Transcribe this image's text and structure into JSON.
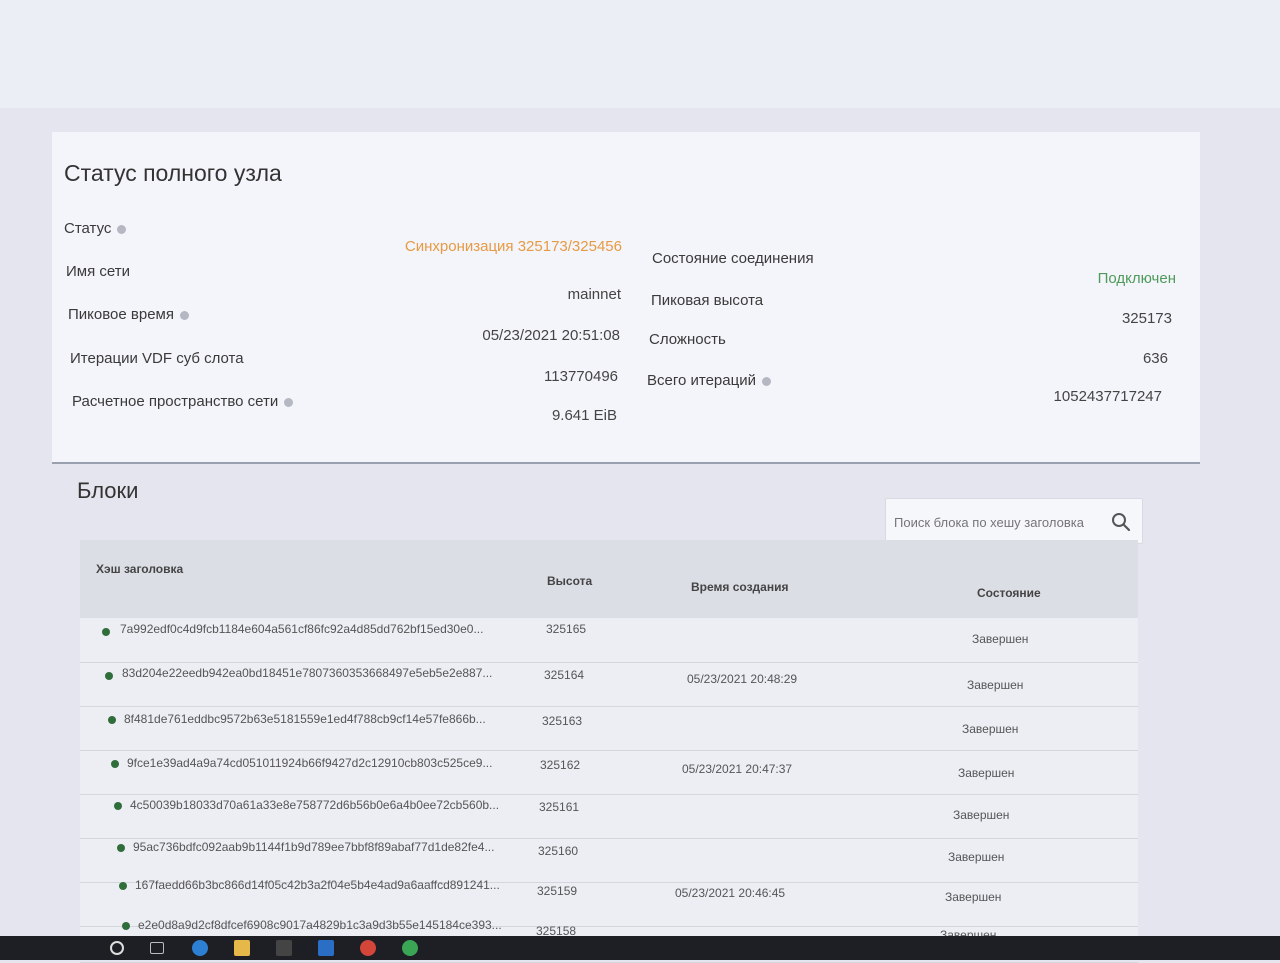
{
  "node_status": {
    "title": "Статус полного узла",
    "left": [
      {
        "label": "Статус",
        "help": true,
        "value": "Синхронизация 325173/325456",
        "tone": "orange"
      },
      {
        "label": "Имя сети",
        "help": false,
        "value": "mainnet",
        "tone": ""
      },
      {
        "label": "Пиковое время",
        "help": true,
        "value": "05/23/2021 20:51:08",
        "tone": ""
      },
      {
        "label": "Итерации VDF суб слота",
        "help": false,
        "value": "113770496",
        "tone": ""
      },
      {
        "label": "Расчетное пространство сети",
        "help": true,
        "value": "9.641 EiB",
        "tone": ""
      }
    ],
    "right": [
      {
        "label": "Состояние соединения",
        "help": false,
        "value": "Подключен",
        "tone": "green"
      },
      {
        "label": "Пиковая высота",
        "help": false,
        "value": "325173",
        "tone": ""
      },
      {
        "label": "Сложность",
        "help": false,
        "value": "636",
        "tone": ""
      },
      {
        "label": "Всего итераций",
        "help": true,
        "value": "1052437717247",
        "tone": ""
      }
    ]
  },
  "blocks": {
    "title": "Блоки",
    "search_placeholder": "Поиск блока по хешу заголовка",
    "columns": [
      "Хэш заголовка",
      "Высота",
      "Время создания",
      "Состояние"
    ],
    "rows": [
      {
        "hash": "7a992edf0c4d9fcb1184e604a561cf86fc92a4d85dd762bf15ed30e0...",
        "height": "325165",
        "time": "",
        "state": "Завершен"
      },
      {
        "hash": "83d204e22eedb942ea0bd18451e7807360353668497e5eb5e2e887...",
        "height": "325164",
        "time": "05/23/2021 20:48:29",
        "state": "Завершен"
      },
      {
        "hash": "8f481de761eddbc9572b63e5181559e1ed4f788cb9cf14e57fe866b...",
        "height": "325163",
        "time": "",
        "state": "Завершен"
      },
      {
        "hash": "9fce1e39ad4a9a74cd051011924b66f9427d2c12910cb803c525ce9...",
        "height": "325162",
        "time": "05/23/2021 20:47:37",
        "state": "Завершен"
      },
      {
        "hash": "4c50039b18033d70a61a33e8e758772d6b56b0e6a4b0ee72cb560b...",
        "height": "325161",
        "time": "",
        "state": "Завершен"
      },
      {
        "hash": "95ac736bdfc092aab9b1144f1b9d789ee7bbf8f89abaf77d1de82fe4...",
        "height": "325160",
        "time": "",
        "state": "Завершен"
      },
      {
        "hash": "167faedd66b3bc866d14f05c42b3a2f04e5b4e4ad9a6aaffcd891241...",
        "height": "325159",
        "time": "05/23/2021 20:46:45",
        "state": "Завершен"
      },
      {
        "hash": "e2e0d8a9d2cf8dfcef6908c9017a4829b1c3a9d3b55e145184ce393...",
        "height": "325158",
        "time": "",
        "state": "Завершен"
      }
    ]
  },
  "colors": {
    "sync": "#e69a43",
    "connected": "#4e9a5a",
    "row_dot": "#2f6e3a"
  },
  "taskbar_icons": [
    "windows-start-icon",
    "task-view-icon",
    "edge-icon",
    "file-explorer-icon",
    "store-icon",
    "mail-icon",
    "chrome-icon",
    "chia-icon"
  ]
}
